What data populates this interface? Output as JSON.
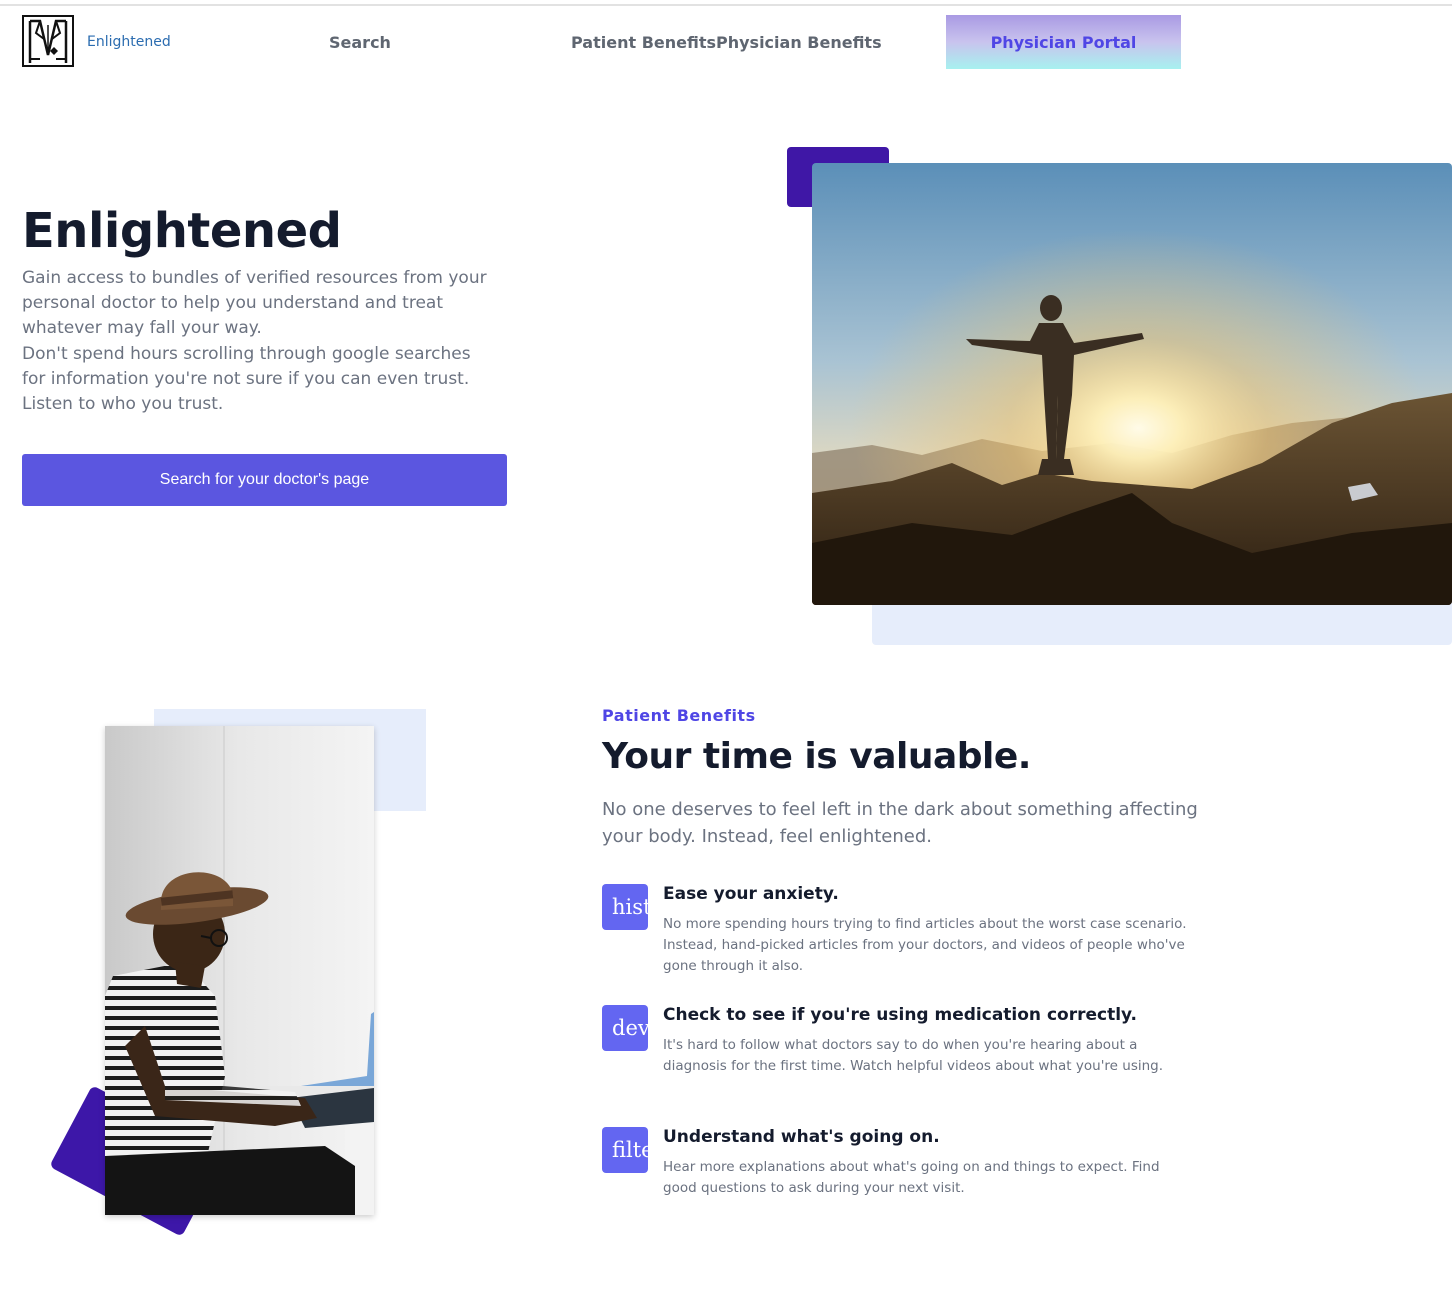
{
  "nav": {
    "logo_text": "Enlightened",
    "links": [
      {
        "label": "Search"
      },
      {
        "label": "Patient Benefits"
      },
      {
        "label": "Physician Benefits"
      }
    ],
    "portal_label": "Physician Portal"
  },
  "hero": {
    "title": "Enlightened",
    "description_lines": [
      "Gain access to bundles of verified resources from your",
      "personal doctor to help you understand and treat",
      "whatever may fall your way.",
      "Don't spend hours scrolling through google searches",
      "for information you're not sure if you can even trust.",
      "Listen to who you trust."
    ],
    "cta_label": "Search for your doctor's page"
  },
  "benefits": {
    "eyebrow": "Patient Benefits",
    "title": "Your time is valuable.",
    "description_lines": [
      "No one deserves to feel left in the dark about something affecting",
      "your body. Instead, feel enlightened."
    ],
    "features": [
      {
        "icon_text": "history",
        "title": "Ease your anxiety.",
        "body_lines": [
          "No more spending hours trying to find articles about the worst case scenario.",
          "Instead, hand-picked articles from your doctors, and videos of people who've",
          "gone through it also."
        ]
      },
      {
        "icon_text": "devices",
        "title": "Check to see if you're using medication correctly.",
        "body_lines": [
          "It's hard to follow what doctors say to do when you're hearing about a",
          "diagnosis for the first time. Watch helpful videos about what you're using."
        ]
      },
      {
        "icon_text": "filter",
        "title": "Understand what's going on.",
        "body_lines": [
          "Hear more explanations about what's going on and things to expect. Find",
          "good questions to ask during your next visit."
        ]
      }
    ]
  },
  "colors": {
    "primary": "#5b56e0",
    "accent_indigo": "#4f46e5",
    "deep_purple": "#3f17a6",
    "pale_blue": "#e6edfb",
    "heading": "#141b2d",
    "body_text": "#6b7280"
  }
}
